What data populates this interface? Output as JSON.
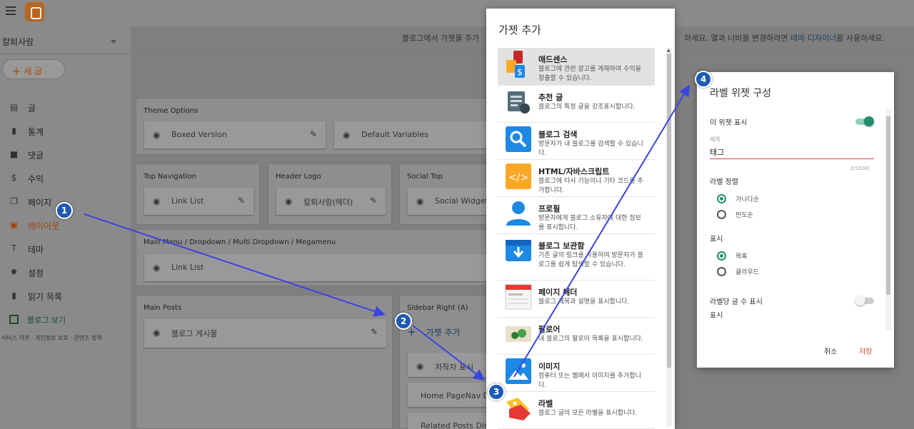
{
  "app": {
    "blog_name": "칼퇴사랑"
  },
  "sidebar": {
    "new_post_label": "새 글",
    "items": [
      {
        "label": "글",
        "icon": "posts-icon"
      },
      {
        "label": "통계",
        "icon": "stats-icon"
      },
      {
        "label": "댓글",
        "icon": "comments-icon"
      },
      {
        "label": "수익",
        "icon": "earnings-icon"
      },
      {
        "label": "페이지",
        "icon": "pages-icon"
      },
      {
        "label": "레이아웃",
        "icon": "layout-icon",
        "active": true
      },
      {
        "label": "테마",
        "icon": "theme-icon"
      },
      {
        "label": "설정",
        "icon": "settings-icon"
      },
      {
        "label": "읽기 목록",
        "icon": "reading-list-icon"
      }
    ],
    "view_blog_label": "블로그 보기",
    "footer_links": "서비스 약관 · 개인정보 보호 · 콘텐츠 정책"
  },
  "layout": {
    "hint_left": "블로그에서 가젯을 추가",
    "hint_right_pre": "하세요. 열과 너비를 변경하려면 ",
    "hint_link": "테마 디자이너",
    "hint_right_post": "를 사용하세요.",
    "theme_options": {
      "title": "Theme Options",
      "gadgets": [
        "Boxed Version",
        "Default Variables"
      ]
    },
    "top_navigation": {
      "title": "Top Navigation",
      "gadget": "Link List"
    },
    "header_logo": {
      "title": "Header Logo",
      "gadget": "칼퇴사랑(헤더)"
    },
    "social_top": {
      "title": "Social Top",
      "gadget": "Social Widget"
    },
    "main_menu": {
      "title": "Main Menu / Dropdown / Multi Dropdown / Megamenu",
      "gadget": "Link List"
    },
    "main_posts": {
      "title": "Main Posts",
      "gadget": "블로그 게시물"
    },
    "sidebar_right": {
      "title": "Sidebar Right (A)",
      "add_label": "가젯 추가",
      "gadgets": [
        "저작자 표시",
        "Home PageNav Dis",
        "Related Posts Disp"
      ]
    }
  },
  "add_gadget_dialog": {
    "title": "가젯 추가",
    "items": [
      {
        "name": "애드센스",
        "desc": "블로그에 관련 광고를 게재하여 수익을 창출할 수 있습니다.",
        "icon": "adsense-icon",
        "selected": true
      },
      {
        "name": "추천 글",
        "desc": "블로그의 특정 글을 강조표시합니다.",
        "icon": "featured-post-icon"
      },
      {
        "name": "블로그 검색",
        "desc": "방문자가 내 블로그를 검색할 수 있습니다.",
        "icon": "search-icon"
      },
      {
        "name": "HTML/자바스크립트",
        "desc": "블로그에 타사 기능이나 기타 코드를 추가합니다.",
        "icon": "code-icon"
      },
      {
        "name": "프로필",
        "desc": "방문자에게 블로그 소유자에 대한 정보를 표시합니다.",
        "icon": "profile-icon"
      },
      {
        "name": "블로그 보관함",
        "desc": "기존 글의 링크를 사용하여 방문자가 블로그를 쉽게 탐색할 수 있습니다.",
        "icon": "archive-icon"
      },
      {
        "name": "페이지 헤더",
        "desc": "블로그 제목과 설명을 표시합니다.",
        "icon": "header-icon"
      },
      {
        "name": "팔로어",
        "desc": "내 블로그의 팔로어 목록을 표시합니다.",
        "icon": "followers-icon"
      },
      {
        "name": "이미지",
        "desc": "컴퓨터 또는 웹에서 이미지를 추가합니다.",
        "icon": "image-icon"
      },
      {
        "name": "라벨",
        "desc": "블로그 글의 모든 라벨을 표시합니다.",
        "icon": "label-icon"
      }
    ]
  },
  "label_config": {
    "title": "라벨 위젯 구성",
    "show_widget_label": "이 위젯 표시",
    "show_widget_on": true,
    "title_field_label": "제목",
    "title_value": "태그",
    "counter": "2/100자",
    "sort_label": "라벨 정렬",
    "sort_options": [
      "가나다순",
      "빈도순"
    ],
    "sort_selected": 0,
    "display_label": "표시",
    "display_options": [
      "목록",
      "클라우드"
    ],
    "display_selected": 0,
    "count_label": "라벨당 글 수 표시",
    "count_on": false,
    "display_label_2": "표시",
    "cancel_label": "취소",
    "save_label": "저장"
  },
  "annotations": [
    "1",
    "2",
    "3",
    "4"
  ],
  "colors": {
    "accent": "#1f8f6e",
    "save": "#d24a2a",
    "badge": "#1e5ab2",
    "arrow": "#3a45e0"
  }
}
